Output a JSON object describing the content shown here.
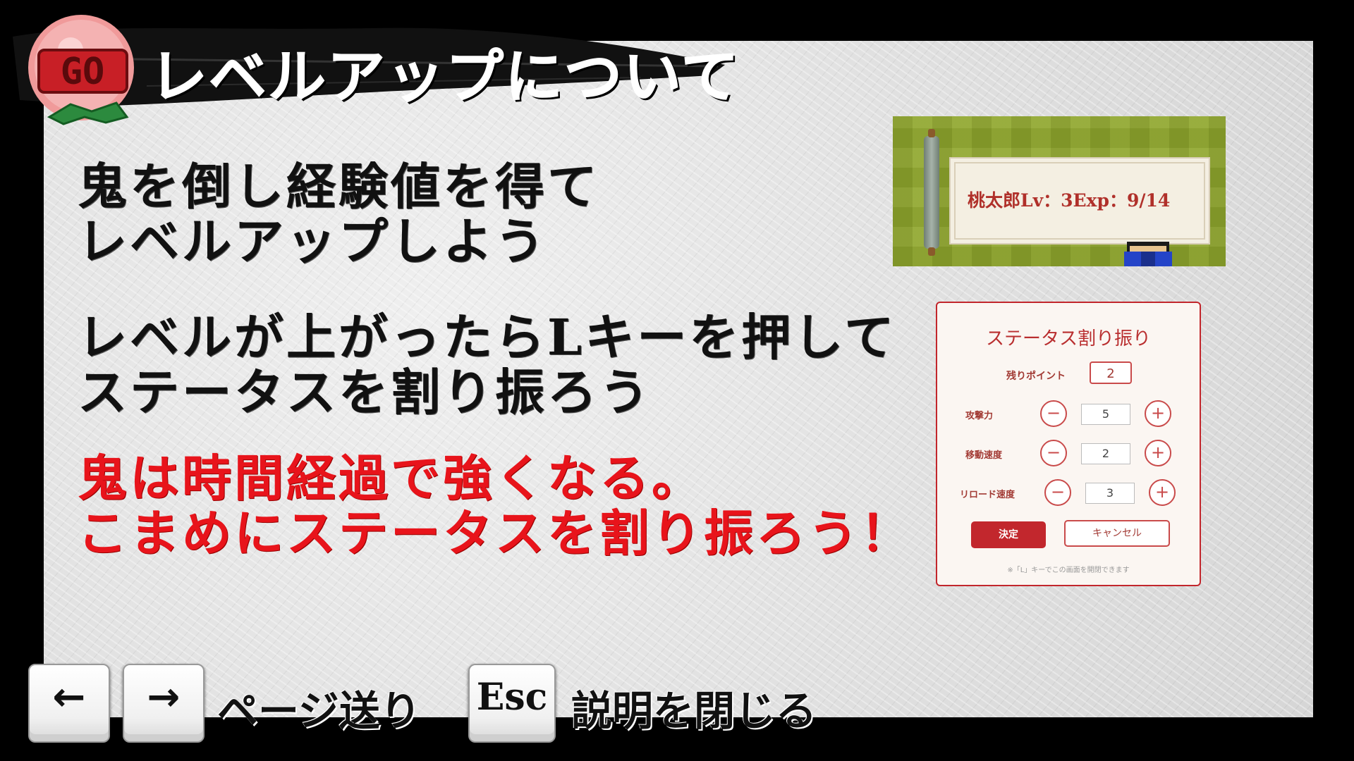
{
  "header": {
    "title": "レベルアップについて",
    "badge_text": "GO"
  },
  "instructions": {
    "line1": "鬼を倒し経験値を得て",
    "line2": "レベルアップしよう",
    "line3": "レベルが上がったらLキーを押して",
    "line4": "ステータスを割り振ろう",
    "warning_line1": "鬼は時間経過で強くなる。",
    "warning_line2": "こまめにステータスを割り振ろう！"
  },
  "hud_sample": {
    "level_text": "桃太郎Lv：3Exp：9/14"
  },
  "status_dialog": {
    "title": "ステータス割り振り",
    "remaining_label": "残りポイント",
    "remaining_value": "2",
    "stats": [
      {
        "label": "攻撃力",
        "value": "5"
      },
      {
        "label": "移動速度",
        "value": "2"
      },
      {
        "label": "リロード速度",
        "value": "3"
      }
    ],
    "minus_symbol": "−",
    "plus_symbol": "+",
    "confirm_label": "決定",
    "cancel_label": "キャンセル",
    "footnote": "※「L」キーでこの画面を開閉できます"
  },
  "footer": {
    "left_key": "←",
    "right_key": "→",
    "page_turn_label": "ページ送り",
    "esc_key": "Esc",
    "close_label": "説明を閉じる"
  },
  "colors": {
    "accent_red": "#e8141b",
    "dialog_red": "#c2272d",
    "field_green": "#8fa62c"
  }
}
